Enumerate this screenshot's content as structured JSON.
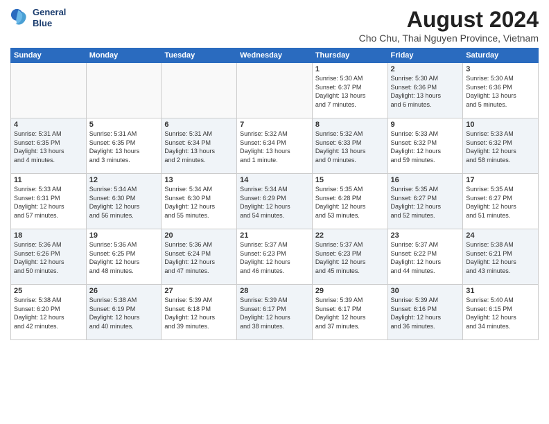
{
  "header": {
    "logo_line1": "General",
    "logo_line2": "Blue",
    "month_year": "August 2024",
    "location": "Cho Chu, Thai Nguyen Province, Vietnam"
  },
  "days_of_week": [
    "Sunday",
    "Monday",
    "Tuesday",
    "Wednesday",
    "Thursday",
    "Friday",
    "Saturday"
  ],
  "weeks": [
    [
      {
        "day": "",
        "info": "",
        "shaded": false,
        "empty": true
      },
      {
        "day": "",
        "info": "",
        "shaded": false,
        "empty": true
      },
      {
        "day": "",
        "info": "",
        "shaded": false,
        "empty": true
      },
      {
        "day": "",
        "info": "",
        "shaded": false,
        "empty": true
      },
      {
        "day": "1",
        "info": "Sunrise: 5:30 AM\nSunset: 6:37 PM\nDaylight: 13 hours\nand 7 minutes.",
        "shaded": false
      },
      {
        "day": "2",
        "info": "Sunrise: 5:30 AM\nSunset: 6:36 PM\nDaylight: 13 hours\nand 6 minutes.",
        "shaded": true
      },
      {
        "day": "3",
        "info": "Sunrise: 5:30 AM\nSunset: 6:36 PM\nDaylight: 13 hours\nand 5 minutes.",
        "shaded": false
      }
    ],
    [
      {
        "day": "4",
        "info": "Sunrise: 5:31 AM\nSunset: 6:35 PM\nDaylight: 13 hours\nand 4 minutes.",
        "shaded": true
      },
      {
        "day": "5",
        "info": "Sunrise: 5:31 AM\nSunset: 6:35 PM\nDaylight: 13 hours\nand 3 minutes.",
        "shaded": false
      },
      {
        "day": "6",
        "info": "Sunrise: 5:31 AM\nSunset: 6:34 PM\nDaylight: 13 hours\nand 2 minutes.",
        "shaded": true
      },
      {
        "day": "7",
        "info": "Sunrise: 5:32 AM\nSunset: 6:34 PM\nDaylight: 13 hours\nand 1 minute.",
        "shaded": false
      },
      {
        "day": "8",
        "info": "Sunrise: 5:32 AM\nSunset: 6:33 PM\nDaylight: 13 hours\nand 0 minutes.",
        "shaded": true
      },
      {
        "day": "9",
        "info": "Sunrise: 5:33 AM\nSunset: 6:32 PM\nDaylight: 12 hours\nand 59 minutes.",
        "shaded": false
      },
      {
        "day": "10",
        "info": "Sunrise: 5:33 AM\nSunset: 6:32 PM\nDaylight: 12 hours\nand 58 minutes.",
        "shaded": true
      }
    ],
    [
      {
        "day": "11",
        "info": "Sunrise: 5:33 AM\nSunset: 6:31 PM\nDaylight: 12 hours\nand 57 minutes.",
        "shaded": false
      },
      {
        "day": "12",
        "info": "Sunrise: 5:34 AM\nSunset: 6:30 PM\nDaylight: 12 hours\nand 56 minutes.",
        "shaded": true
      },
      {
        "day": "13",
        "info": "Sunrise: 5:34 AM\nSunset: 6:30 PM\nDaylight: 12 hours\nand 55 minutes.",
        "shaded": false
      },
      {
        "day": "14",
        "info": "Sunrise: 5:34 AM\nSunset: 6:29 PM\nDaylight: 12 hours\nand 54 minutes.",
        "shaded": true
      },
      {
        "day": "15",
        "info": "Sunrise: 5:35 AM\nSunset: 6:28 PM\nDaylight: 12 hours\nand 53 minutes.",
        "shaded": false
      },
      {
        "day": "16",
        "info": "Sunrise: 5:35 AM\nSunset: 6:27 PM\nDaylight: 12 hours\nand 52 minutes.",
        "shaded": true
      },
      {
        "day": "17",
        "info": "Sunrise: 5:35 AM\nSunset: 6:27 PM\nDaylight: 12 hours\nand 51 minutes.",
        "shaded": false
      }
    ],
    [
      {
        "day": "18",
        "info": "Sunrise: 5:36 AM\nSunset: 6:26 PM\nDaylight: 12 hours\nand 50 minutes.",
        "shaded": true
      },
      {
        "day": "19",
        "info": "Sunrise: 5:36 AM\nSunset: 6:25 PM\nDaylight: 12 hours\nand 48 minutes.",
        "shaded": false
      },
      {
        "day": "20",
        "info": "Sunrise: 5:36 AM\nSunset: 6:24 PM\nDaylight: 12 hours\nand 47 minutes.",
        "shaded": true
      },
      {
        "day": "21",
        "info": "Sunrise: 5:37 AM\nSunset: 6:23 PM\nDaylight: 12 hours\nand 46 minutes.",
        "shaded": false
      },
      {
        "day": "22",
        "info": "Sunrise: 5:37 AM\nSunset: 6:23 PM\nDaylight: 12 hours\nand 45 minutes.",
        "shaded": true
      },
      {
        "day": "23",
        "info": "Sunrise: 5:37 AM\nSunset: 6:22 PM\nDaylight: 12 hours\nand 44 minutes.",
        "shaded": false
      },
      {
        "day": "24",
        "info": "Sunrise: 5:38 AM\nSunset: 6:21 PM\nDaylight: 12 hours\nand 43 minutes.",
        "shaded": true
      }
    ],
    [
      {
        "day": "25",
        "info": "Sunrise: 5:38 AM\nSunset: 6:20 PM\nDaylight: 12 hours\nand 42 minutes.",
        "shaded": false
      },
      {
        "day": "26",
        "info": "Sunrise: 5:38 AM\nSunset: 6:19 PM\nDaylight: 12 hours\nand 40 minutes.",
        "shaded": true
      },
      {
        "day": "27",
        "info": "Sunrise: 5:39 AM\nSunset: 6:18 PM\nDaylight: 12 hours\nand 39 minutes.",
        "shaded": false
      },
      {
        "day": "28",
        "info": "Sunrise: 5:39 AM\nSunset: 6:17 PM\nDaylight: 12 hours\nand 38 minutes.",
        "shaded": true
      },
      {
        "day": "29",
        "info": "Sunrise: 5:39 AM\nSunset: 6:17 PM\nDaylight: 12 hours\nand 37 minutes.",
        "shaded": false
      },
      {
        "day": "30",
        "info": "Sunrise: 5:39 AM\nSunset: 6:16 PM\nDaylight: 12 hours\nand 36 minutes.",
        "shaded": true
      },
      {
        "day": "31",
        "info": "Sunrise: 5:40 AM\nSunset: 6:15 PM\nDaylight: 12 hours\nand 34 minutes.",
        "shaded": false
      }
    ]
  ]
}
